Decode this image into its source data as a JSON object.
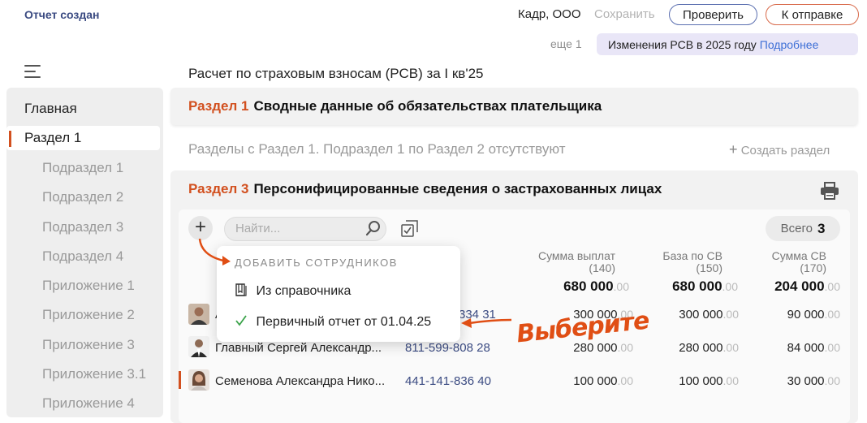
{
  "header": {
    "status": "Отчет создан",
    "org": "Кадр, ООО",
    "save_label": "Сохранить",
    "check_label": "Проверить",
    "send_label": "К отправке",
    "more": "еще 1",
    "news_text": "Изменения РСВ в 2025 году",
    "news_link": "Подробнее"
  },
  "document": {
    "title": "Расчет по страховым взносам (РСВ) за I кв'25"
  },
  "sidebar": {
    "items": [
      {
        "label": "Главная"
      },
      {
        "label": "Раздел 1"
      },
      {
        "label": "Подраздел 1"
      },
      {
        "label": "Подраздел 2"
      },
      {
        "label": "Подраздел 3"
      },
      {
        "label": "Подраздел 4"
      },
      {
        "label": "Приложение 1"
      },
      {
        "label": "Приложение 2"
      },
      {
        "label": "Приложение 3"
      },
      {
        "label": "Приложение 3.1"
      },
      {
        "label": "Приложение 4"
      }
    ]
  },
  "section1": {
    "num": "Раздел 1",
    "title": "Сводные данные об обязательствах плательщика"
  },
  "missing_text": "Разделы с Раздел 1. Подраздел 1 по Раздел 2 отсутствуют",
  "create_label": "Создать раздел",
  "section3": {
    "num": "Раздел 3",
    "title": "Персонифицированные сведения о застрахованных лицах",
    "search_placeholder": "Найти...",
    "total_label": "Всего",
    "total_count": "3",
    "columns": [
      {
        "label": "Сумма выплат",
        "code": "(140)",
        "total": "680 000",
        "dec": ".00"
      },
      {
        "label": "База по СВ",
        "code": "(150)",
        "total": "680 000",
        "dec": ".00"
      },
      {
        "label": "Сумма СВ",
        "code": "(170)",
        "total": "204 000",
        "dec": ".00"
      }
    ],
    "rows": [
      {
        "name": "А",
        "snils": "334 31",
        "v1": "300 000",
        "v2": "300 000",
        "v3": "90 000",
        "dec": ".00"
      },
      {
        "name": "Главный Сергей Александр...",
        "snils": "811-599-808 28",
        "v1": "280 000",
        "v2": "280 000",
        "v3": "84 000",
        "dec": ".00"
      },
      {
        "name": "Семенова Александра Нико...",
        "snils": "441-141-836 40",
        "v1": "100 000",
        "v2": "100 000",
        "v3": "30 000",
        "dec": ".00"
      }
    ]
  },
  "dropdown": {
    "heading": "ДОБАВИТЬ СОТРУДНИКОВ",
    "items": [
      {
        "label": "Из справочника"
      },
      {
        "label": "Первичный отчет от 01.04.25"
      }
    ]
  },
  "annotation": {
    "text": "Выберите",
    "color": "#e04e14"
  },
  "colors": {
    "accent": "#d2501f",
    "link": "#3d6fd6",
    "brand": "#3b4b82"
  }
}
